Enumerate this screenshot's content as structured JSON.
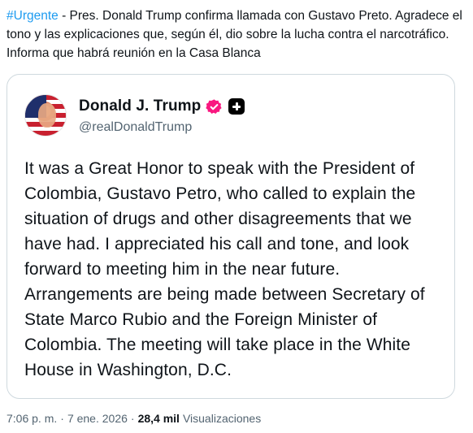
{
  "post": {
    "hashtag": "#Urgente",
    "text": " - Pres. Donald Trump confirma llamada con Gustavo Preto. Agradece el tono y las explicaciones que, según él, dio sobre la lucha contra el narcotráfico.  Informa que habrá reunión en la Casa Blanca"
  },
  "quoted": {
    "display_name": "Donald J. Trump",
    "handle": "@realDonaldTrump",
    "badge_color": "#f91880",
    "body": "It was a Great Honor to speak with the President of Colombia, Gustavo Petro, who called to explain the situation of drugs and other disagreements that we have had. I appreciated his call and tone, and look forward to meeting him in the near future. Arrangements are being made between Secretary of State Marco Rubio and the Foreign Minister of Colombia. The meeting will take place in the White House in Washington, D.C."
  },
  "meta": {
    "time": "7:06 p. m.",
    "separator": "·",
    "date": "7 ene. 2026",
    "views_count": "28,4 mil",
    "views_label": "Visualizaciones"
  }
}
